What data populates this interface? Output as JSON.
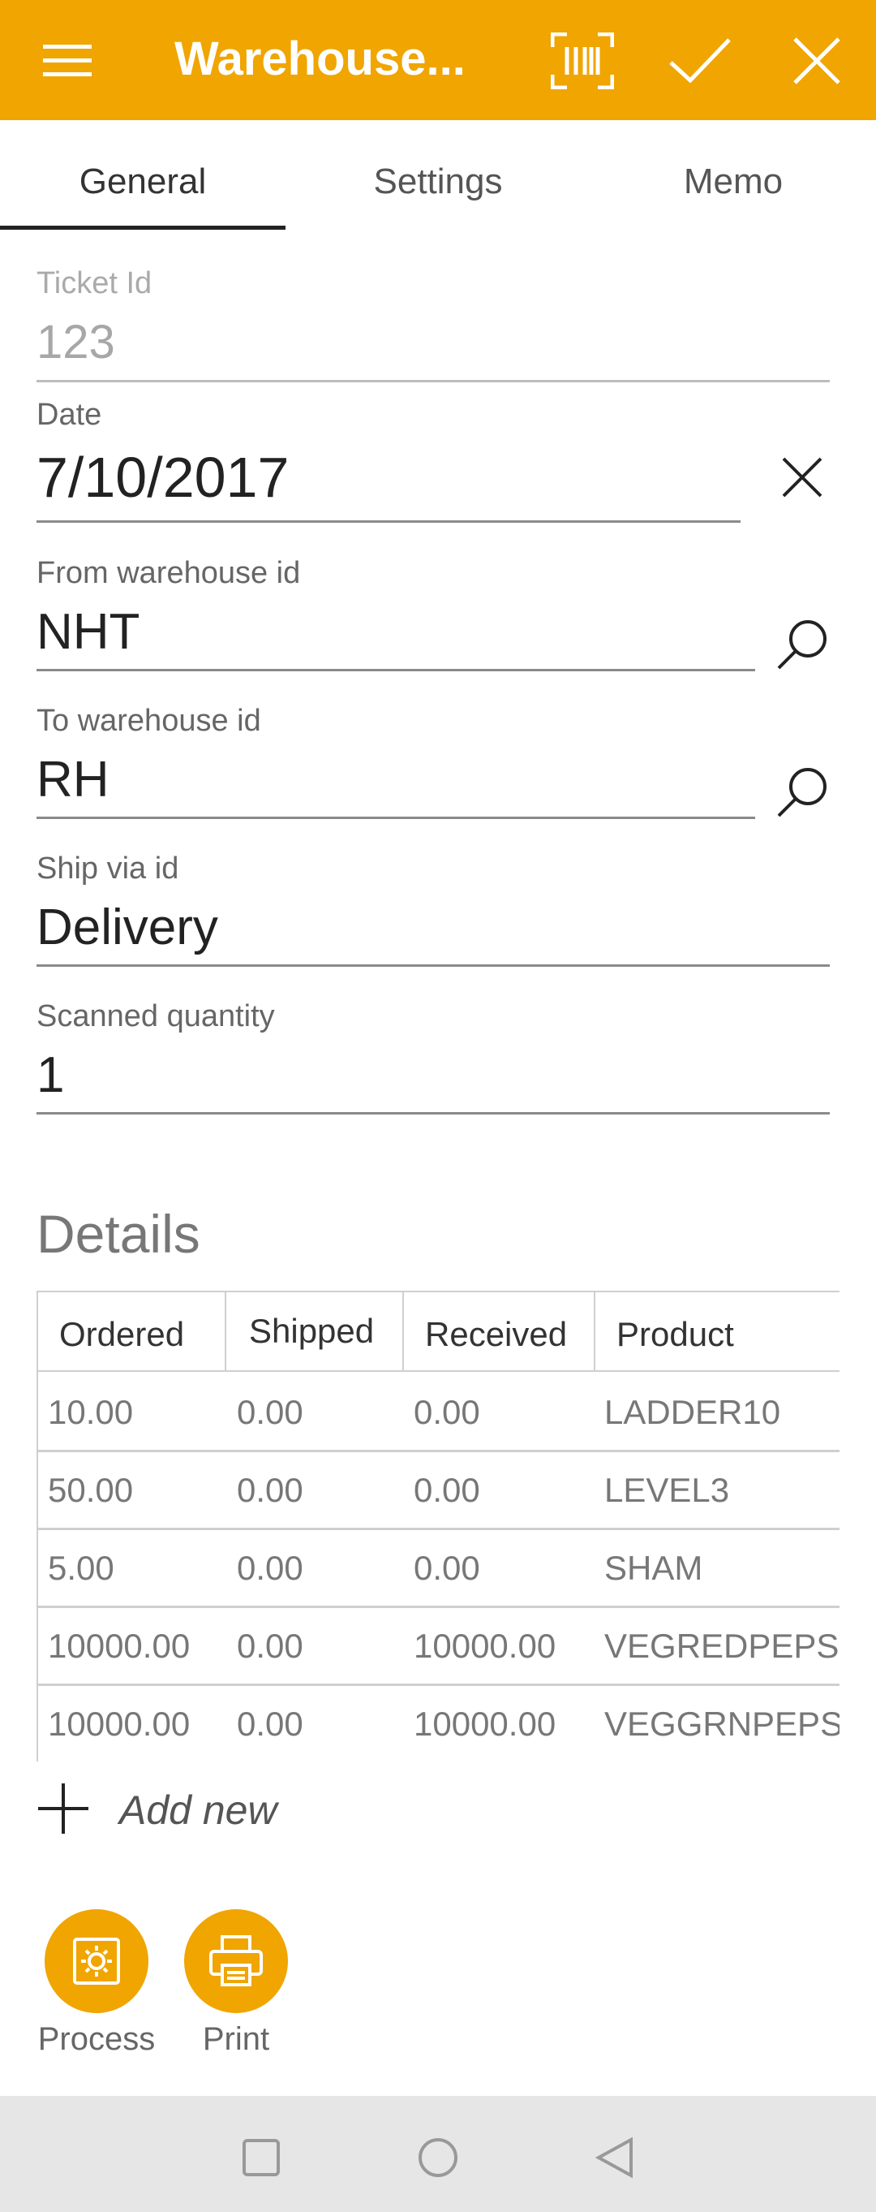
{
  "appbar": {
    "title": "Warehouse...",
    "icons": [
      "menu-icon",
      "barcode-scan-icon",
      "checkmark-icon",
      "close-icon"
    ],
    "background": "#F0A500"
  },
  "tabs": [
    {
      "label": "General",
      "active": true
    },
    {
      "label": "Settings",
      "active": false
    },
    {
      "label": "Memo",
      "active": false
    }
  ],
  "fields": {
    "ticket_id": {
      "label": "Ticket Id",
      "value": "123"
    },
    "date": {
      "label": "Date",
      "value": "7/10/2017"
    },
    "from_warehouse": {
      "label": "From warehouse id",
      "value": "NHT"
    },
    "to_warehouse": {
      "label": "To warehouse id",
      "value": "RH"
    },
    "ship_via": {
      "label": "Ship via id",
      "value": "Delivery"
    },
    "scanned_qty": {
      "label": "Scanned quantity",
      "value": "1"
    }
  },
  "details": {
    "title": "Details",
    "columns": [
      "Ordered",
      "Shipped",
      "Received",
      "Product"
    ],
    "rows": [
      [
        "10.00",
        "0.00",
        "0.00",
        "LADDER10"
      ],
      [
        "50.00",
        "0.00",
        "0.00",
        "LEVEL3"
      ],
      [
        "5.00",
        "0.00",
        "0.00",
        "SHAM"
      ],
      [
        "10000.00",
        "0.00",
        "10000.00",
        "VEGREDPEPS"
      ],
      [
        "10000.00",
        "0.00",
        "10000.00",
        "VEGGRNPEPS"
      ]
    ],
    "add_new_label": "Add new"
  },
  "actions": {
    "process_label": "Process",
    "print_label": "Print"
  }
}
